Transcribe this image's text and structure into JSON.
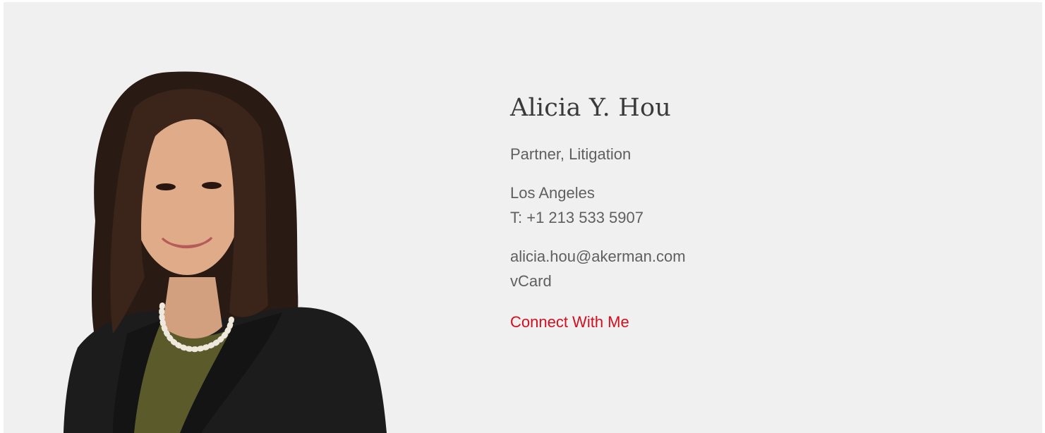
{
  "profile": {
    "name": "Alicia Y. Hou",
    "title": "Partner, Litigation",
    "office": "Los Angeles",
    "phone": "T: +1 213 533 5907",
    "email": "alicia.hou@akerman.com",
    "vcard": "vCard",
    "connect": "Connect With Me"
  },
  "colors": {
    "background": "#f0f0f0",
    "accent": "#d10f1f",
    "text": "#5f5f5f",
    "heading": "#3a3a3a"
  }
}
